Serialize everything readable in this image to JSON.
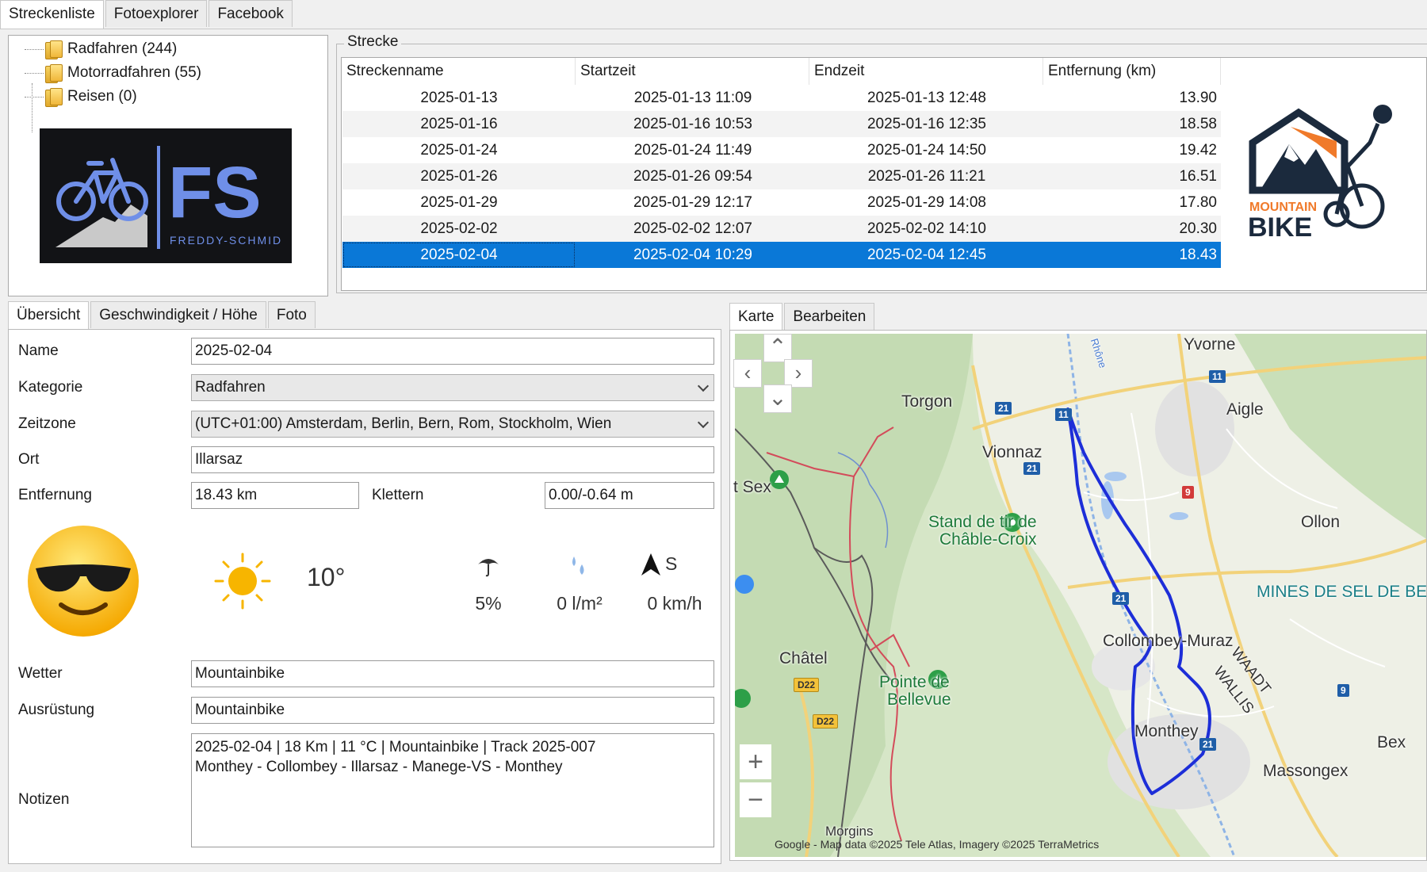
{
  "top_tabs": [
    "Streckenliste",
    "Fotoexplorer",
    "Facebook"
  ],
  "tree": [
    {
      "label": "Radfahren (244)"
    },
    {
      "label": "Motorradfahren (55)"
    },
    {
      "label": "Reisen (0)"
    }
  ],
  "fs_logo": {
    "text": "FS",
    "sub": "FREDDY-SCHMID"
  },
  "strecke": {
    "legend": "Strecke",
    "columns": [
      "Streckenname",
      "Startzeit",
      "Endzeit",
      "Entfernung (km)"
    ],
    "rows": [
      [
        "2025-01-13",
        "2025-01-13 11:09",
        "2025-01-13 12:48",
        "13.90"
      ],
      [
        "2025-01-16",
        "2025-01-16 10:53",
        "2025-01-16 12:35",
        "18.58"
      ],
      [
        "2025-01-24",
        "2025-01-24 11:49",
        "2025-01-24 14:50",
        "19.42"
      ],
      [
        "2025-01-26",
        "2025-01-26 09:54",
        "2025-01-26 11:21",
        "16.51"
      ],
      [
        "2025-01-29",
        "2025-01-29 12:17",
        "2025-01-29 14:08",
        "17.80"
      ],
      [
        "2025-02-02",
        "2025-02-02 12:07",
        "2025-02-02 14:10",
        "20.30"
      ],
      [
        "2025-02-04",
        "2025-02-04 10:29",
        "2025-02-04 12:45",
        "18.43"
      ]
    ],
    "selected_index": 6
  },
  "mb_logo": {
    "line1": "MOUNTAIN",
    "line2": "BIKE"
  },
  "detail_tabs": [
    "Übersicht",
    "Geschwindigkeit / Höhe",
    "Foto"
  ],
  "detail": {
    "name_label": "Name",
    "name_value": "2025-02-04",
    "kategorie_label": "Kategorie",
    "kategorie_value": "Radfahren",
    "zeitzone_label": "Zeitzone",
    "zeitzone_value": "(UTC+01:00) Amsterdam, Berlin, Bern, Rom, Stockholm, Wien",
    "ort_label": "Ort",
    "ort_value": "Illarsaz",
    "entfernung_label": "Entfernung",
    "entfernung_value": "18.43 km",
    "klettern_label": "Klettern",
    "klettern_value": "0.00/-0.64 m",
    "wetter_label": "Wetter",
    "wetter_value": "Mountainbike",
    "ausruestung_label": "Ausrüstung",
    "ausruestung_value": "Mountainbike",
    "notizen_label": "Notizen",
    "notizen_line1": "2025-02-04  |  18 Km  |  11 °C  |  Mountainbike  |  Track 2025-007",
    "notizen_line2": "Monthey - Collombey - Illarsaz - Manege-VS - Monthey"
  },
  "weather": {
    "temperature": "10°",
    "precip_chance": "5%",
    "rain": "0 l/m²",
    "wind_dir": "S",
    "wind_speed": "0 km/h"
  },
  "map_tabs": [
    "Karte",
    "Bearbeiten"
  ],
  "map": {
    "places": {
      "yvorne": "Yvorne",
      "aigle": "Aigle",
      "torgon": "Torgon",
      "vionnaz": "Vionnaz",
      "tsex": "t Sex",
      "stand": "Stand de tir de",
      "chable": "Châble-Croix",
      "ollon": "Ollon",
      "mines": "MINES DE SEL DE BEX",
      "collombey": "Collombey-Muraz",
      "waadt": "WAADT",
      "wallis": "WALLIS",
      "chatel": "Châtel",
      "pointe": "Pointe de",
      "bellevue": "Bellevue",
      "monthey": "Monthey",
      "bex": "Bex",
      "massongex": "Massongex",
      "rhone": "Rhône",
      "morgins": "Morgins"
    },
    "roads": {
      "r21": "21",
      "r11": "11",
      "r9": "9",
      "d22": "D22"
    },
    "zoom_in": "+",
    "zoom_out": "−",
    "attribution": "Google - Map data ©2025 Tele Atlas, Imagery ©2025 TerraMetrics"
  }
}
